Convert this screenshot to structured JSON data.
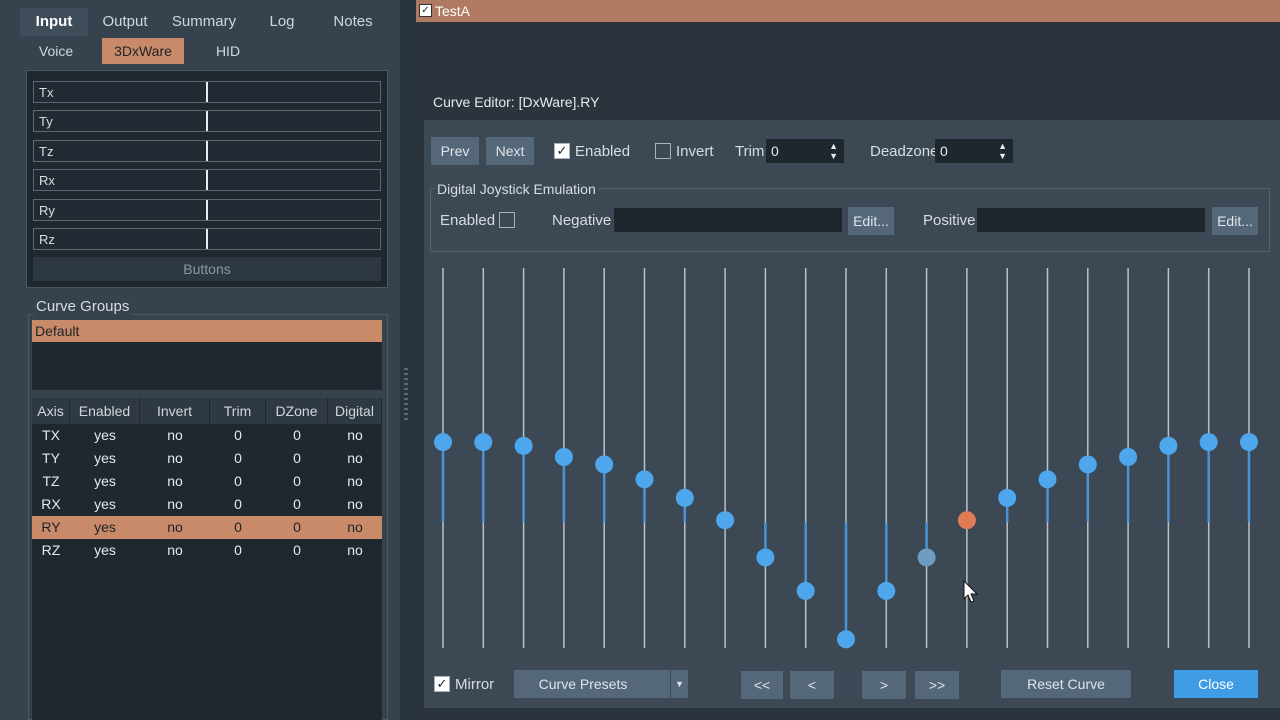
{
  "tabs": [
    "Input",
    "Output",
    "Summary",
    "Log",
    "Notes"
  ],
  "subtabs": [
    "Voice",
    "3DxWare",
    "HID"
  ],
  "axes_panel": {
    "axes": [
      "Tx",
      "Ty",
      "Tz",
      "Rx",
      "Ry",
      "Rz"
    ],
    "buttons_label": "Buttons"
  },
  "curve_groups": {
    "label": "Curve Groups",
    "items": [
      "Default"
    ]
  },
  "axis_table": {
    "headers": [
      "Axis",
      "Enabled",
      "Invert",
      "Trim",
      "DZone",
      "Digital"
    ],
    "rows": [
      [
        "TX",
        "yes",
        "no",
        "0",
        "0",
        "no"
      ],
      [
        "TY",
        "yes",
        "no",
        "0",
        "0",
        "no"
      ],
      [
        "TZ",
        "yes",
        "no",
        "0",
        "0",
        "no"
      ],
      [
        "RX",
        "yes",
        "no",
        "0",
        "0",
        "no"
      ],
      [
        "RY",
        "yes",
        "no",
        "0",
        "0",
        "no"
      ],
      [
        "RZ",
        "yes",
        "no",
        "0",
        "0",
        "no"
      ]
    ],
    "selected_index": 4
  },
  "topbar": {
    "title": "TestA",
    "checked": true
  },
  "editor": {
    "title": "Curve Editor: [DxWare].RY",
    "prev_label": "Prev",
    "next_label": "Next",
    "enabled_label": "Enabled",
    "invert_label": "Invert",
    "trim_label": "Trim",
    "trim_value": "0",
    "deadzone_label": "Deadzone",
    "deadzone_value": "0",
    "dje": {
      "title": "Digital Joystick Emulation",
      "enabled_label": "Enabled",
      "negative_label": "Negative",
      "positive_label": "Positive",
      "edit_label": "Edit..."
    },
    "mirror_label": "Mirror",
    "presets_label": "Curve Presets",
    "nav": [
      "<<",
      "<",
      ">",
      ">>"
    ],
    "reset_label": "Reset Curve",
    "close_label": "Close"
  },
  "curve": {
    "point_levels": [
      0.54,
      0.54,
      0.53,
      0.5,
      0.48,
      0.44,
      0.39,
      0.33,
      0.23,
      0.14,
      0.01,
      0.14,
      0.23,
      0.33,
      0.39,
      0.44,
      0.48,
      0.5,
      0.53,
      0.54,
      0.54
    ],
    "selected_index": 13,
    "hover_index": 12,
    "colors": {
      "point": "#4ea6ec",
      "selected": "#e07a55",
      "hover": "#6e9cc3",
      "fill": "#4a93d6",
      "track": "#b8c2ca"
    }
  }
}
